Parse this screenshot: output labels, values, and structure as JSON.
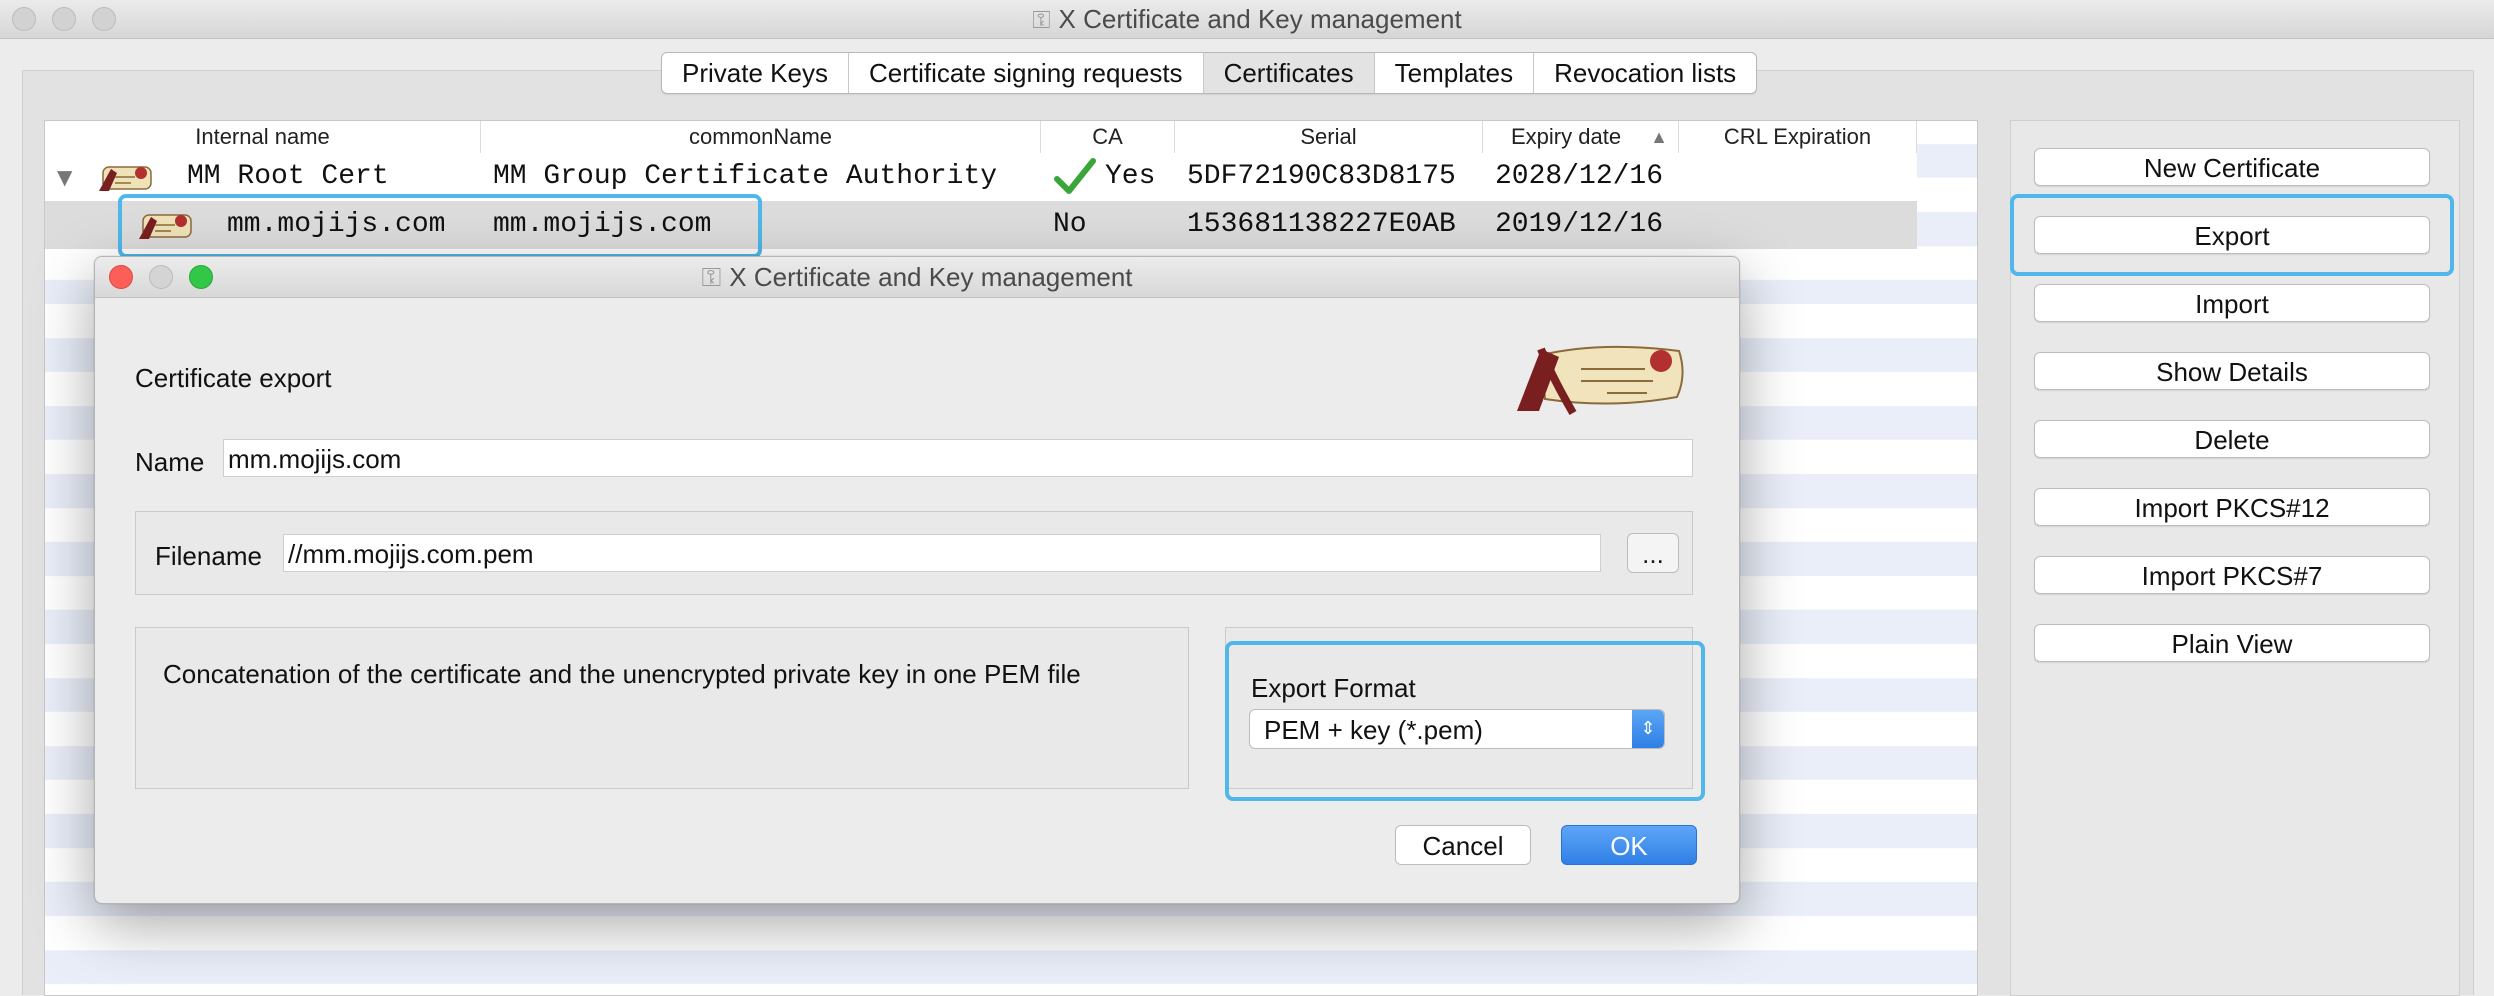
{
  "window": {
    "title": "X Certificate and Key management"
  },
  "tabs": [
    {
      "label": "Private Keys"
    },
    {
      "label": "Certificate signing requests"
    },
    {
      "label": "Certificates"
    },
    {
      "label": "Templates"
    },
    {
      "label": "Revocation lists"
    }
  ],
  "active_tab": "Certificates",
  "table": {
    "columns": [
      "Internal name",
      "commonName",
      "CA",
      "Serial",
      "Expiry date",
      "CRL Expiration"
    ],
    "sort_indicator": "▲",
    "rows": [
      {
        "internal_name": "MM Root Cert",
        "common_name": "MM Group Certificate Authority",
        "ca": "Yes",
        "serial": "5DF72190C83D8175",
        "expiry": "2028/12/16",
        "crl": ""
      },
      {
        "internal_name": "mm.mojijs.com",
        "common_name": "mm.mojijs.com",
        "ca": "No",
        "serial": "153681138227E0AB",
        "expiry": "2019/12/16",
        "crl": ""
      }
    ]
  },
  "side_buttons": {
    "new_certificate": "New Certificate",
    "export": "Export",
    "import": "Import",
    "show_details": "Show Details",
    "delete": "Delete",
    "import_pkcs12": "Import PKCS#12",
    "import_pkcs7": "Import PKCS#7",
    "plain_view": "Plain View"
  },
  "dialog": {
    "title": "X Certificate and Key management",
    "heading": "Certificate export",
    "name_label": "Name",
    "name_value": "mm.mojijs.com",
    "filename_label": "Filename",
    "filename_value": "//mm.mojijs.com.pem",
    "browse_label": "...",
    "description": "Concatenation of the certificate and the unencrypted private key in one PEM file",
    "format_label": "Export Format",
    "format_value": "PEM + key (*.pem)",
    "cancel_label": "Cancel",
    "ok_label": "OK"
  },
  "colors": {
    "highlight": "#4fb7e9",
    "ok_button": "#3b8cf0",
    "check": "#3aa63a",
    "row_selected": "#dcdcdc",
    "row_stripe": "#e9eef8"
  },
  "icons": [
    "certificate-icon",
    "checkmark-icon",
    "chevron-updown-icon",
    "disclosure-triangle-icon",
    "key-icon"
  ]
}
